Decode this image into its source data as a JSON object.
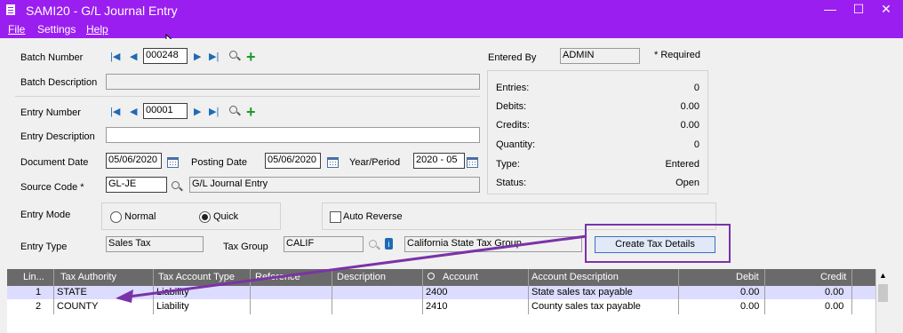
{
  "window": {
    "title": "SAMI20 - G/L Journal Entry",
    "minimize": "—",
    "maximize": "☐",
    "close": "✕"
  },
  "menu": {
    "file": "File",
    "settings": "Settings",
    "help": "Help"
  },
  "labels": {
    "batch_number": "Batch Number",
    "batch_description": "Batch Description",
    "entry_number": "Entry Number",
    "entry_description": "Entry Description",
    "document_date": "Document Date",
    "posting_date": "Posting Date",
    "year_period": "Year/Period",
    "source_code": "Source Code *",
    "entry_mode": "Entry Mode",
    "entry_type": "Entry Type",
    "tax_group": "Tax Group",
    "entered_by": "Entered By",
    "required": "* Required"
  },
  "values": {
    "batch_number": "000248",
    "entry_number": "00001",
    "document_date": "05/06/2020",
    "posting_date": "05/06/2020",
    "year_period": "2020 - 05",
    "source_code": "GL-JE",
    "source_code_desc": "G/L Journal Entry",
    "entered_by": "ADMIN",
    "entry_type": "Sales Tax",
    "tax_group": "CALIF",
    "tax_group_desc": "California State Tax Group"
  },
  "summary": [
    {
      "label": "Entries:",
      "value": "0"
    },
    {
      "label": "Debits:",
      "value": "0.00"
    },
    {
      "label": "Credits:",
      "value": "0.00"
    },
    {
      "label": "Quantity:",
      "value": "0"
    },
    {
      "label": "Type:",
      "value": "Entered"
    },
    {
      "label": "Status:",
      "value": "Open"
    }
  ],
  "entry_mode": {
    "normal": "Normal",
    "quick": "Quick",
    "selected": "Quick"
  },
  "auto_reverse": {
    "label": "Auto Reverse",
    "checked": false
  },
  "buttons": {
    "create_tax_details": "Create Tax Details"
  },
  "grid": {
    "columns": [
      "Lin...",
      "Tax Authority",
      "Tax Account Type",
      "Reference",
      "Description",
      "Account",
      "Account Description",
      "Debit",
      "Credit"
    ],
    "rows": [
      [
        "1",
        "STATE",
        "Liability",
        "",
        "",
        "2400",
        "State sales tax payable",
        "0.00",
        "0.00"
      ],
      [
        "2",
        "COUNTY",
        "Liability",
        "",
        "",
        "2410",
        "County sales tax payable",
        "0.00",
        "0.00"
      ]
    ]
  },
  "colors": {
    "titlebar": "#9b1ef0",
    "highlight_row": "#dcdcff",
    "annotation": "#7b32a8"
  }
}
